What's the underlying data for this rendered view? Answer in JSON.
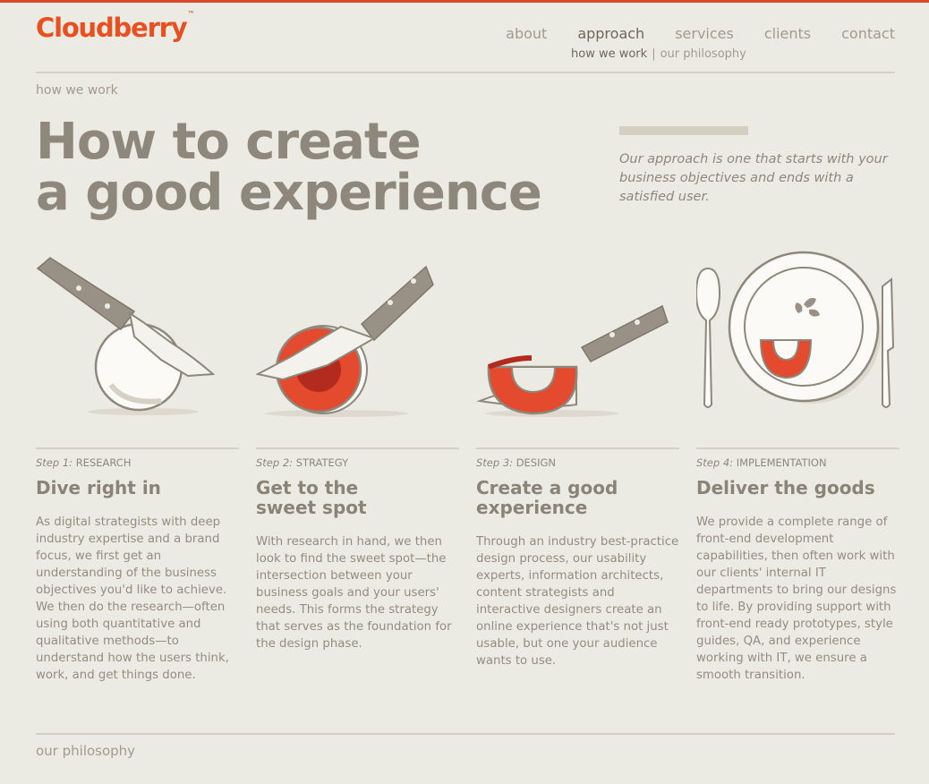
{
  "brand": {
    "name": "Cloudberry",
    "tm": "™",
    "color": "#e8501f"
  },
  "nav": {
    "items": [
      {
        "label": "about",
        "active": false
      },
      {
        "label": "approach",
        "active": true
      },
      {
        "label": "services",
        "active": false
      },
      {
        "label": "clients",
        "active": false
      },
      {
        "label": "contact",
        "active": false
      }
    ],
    "sub": {
      "current": "how we work",
      "separator": "|",
      "other": "our philosophy"
    }
  },
  "section_label": "how we work",
  "hero": {
    "title_line1": "How to create",
    "title_line2": "a good experience",
    "quote": "Our approach is one that starts with your business objectives and ends with a satisfied user."
  },
  "steps": [
    {
      "step_word": "Step 1:",
      "name": "RESEARCH",
      "title": "Dive right in",
      "body": "As digital strategists with deep industry expertise and a brand focus, we first get an understanding of the business objectives you'd like to achieve. We then do the research—often using both quantitative and qualitative methods—to understand how the users think, work, and get things done.",
      "illustration": "knife-cutting-whole-fruit-icon"
    },
    {
      "step_word": "Step 2:",
      "name": "STRATEGY",
      "title": "Get to the sweet spot",
      "body": "With research in hand, we then look to find the sweet spot—the intersection between your business goals and your users' needs. This forms the strategy that serves as the foundation for the design phase.",
      "illustration": "knife-sliced-fruit-icon"
    },
    {
      "step_word": "Step 3:",
      "name": "DESIGN",
      "title": "Create a good experience",
      "body": "Through an industry best-practice design process, our usability experts, information architects, content strategists and interactive designers create an online experience that's not just usable, but one your audience wants to use.",
      "illustration": "knife-fruit-wedge-icon"
    },
    {
      "step_word": "Step 4:",
      "name": "IMPLEMENTATION",
      "title": "Deliver the goods",
      "body": "We provide a complete range of front-end development capabilities, then often work with our clients' internal IT departments to bring our designs to life. By providing support with front-end ready prototypes, style guides, QA, and experience working with IT, we ensure a smooth transition.",
      "illustration": "plated-dish-with-cutlery-icon"
    }
  ],
  "footer_label": "our philosophy",
  "colors": {
    "accent": "#e8501f",
    "fruit": "#e44a2e",
    "fruit_dark": "#b32a1e",
    "text": "#8a8378",
    "background": "#ecebe3",
    "handle": "#9a9186"
  }
}
